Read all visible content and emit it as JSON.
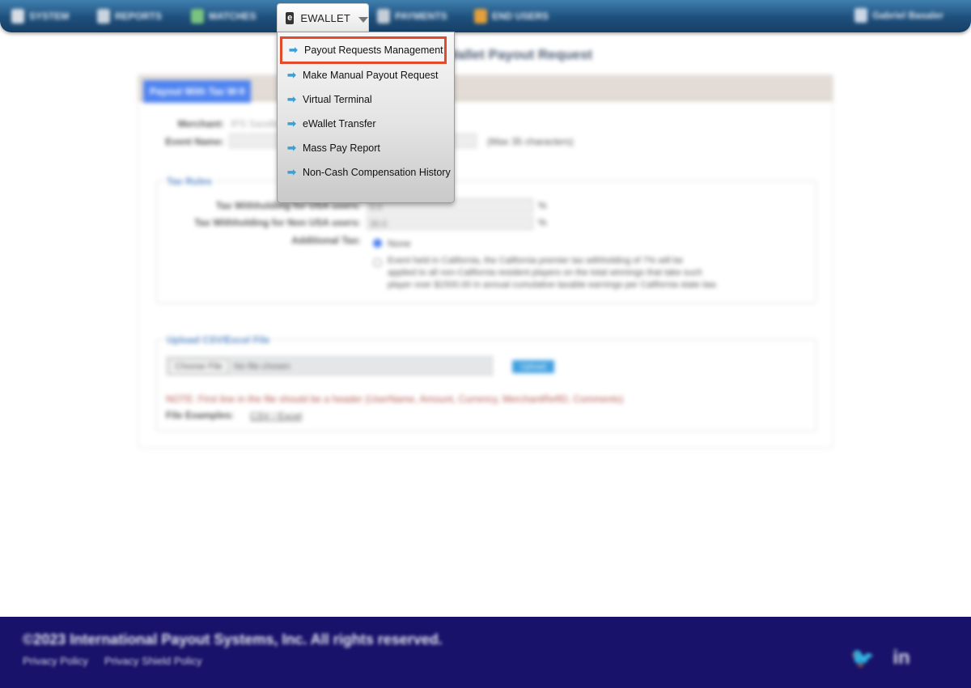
{
  "nav": {
    "items": [
      {
        "label": "SYSTEM",
        "icon": "system-icon",
        "color": "#d7dde5"
      },
      {
        "label": "REPORTS",
        "icon": "reports-icon",
        "color": "#c9d4df"
      },
      {
        "label": "MATCHES",
        "icon": "matches-icon",
        "color": "#7bc47f"
      },
      {
        "label": "PAYMENTS",
        "icon": "payments-icon",
        "color": "#c5ced8"
      },
      {
        "label": "END USERS",
        "icon": "end-users-icon",
        "color": "#e3a03b"
      }
    ],
    "active": {
      "label": "EWALLET",
      "icon_glyph": "e"
    },
    "user_label": "Gabriel Basaler"
  },
  "dropdown": {
    "items": [
      {
        "label": "Payout Requests Management",
        "highlighted": true
      },
      {
        "label": "Make Manual Payout Request",
        "highlighted": false
      },
      {
        "label": "Virtual Terminal",
        "highlighted": false
      },
      {
        "label": "eWallet Transfer",
        "highlighted": false
      },
      {
        "label": "Mass Pay Report",
        "highlighted": false
      },
      {
        "label": "Non-Cash Compensation History",
        "highlighted": false
      }
    ],
    "arrow_glyph": "➡",
    "highlight_color": "#e34a2a"
  },
  "page": {
    "title": "eWallet Payout Request",
    "panel_tab": "Payout With Tax W-9",
    "merchant_label": "Merchant:",
    "merchant_value": "IPS Sandbox",
    "event_label": "Event Name:",
    "event_hint": "(Max 35 characters)",
    "tax": {
      "legend": "Tax Rules",
      "usa_label": "Tax Withholding for USA users:",
      "usa_value": "0.0",
      "non_usa_label": "Tax Withholding for Non USA users:",
      "non_usa_value": "30.0",
      "percent": "%",
      "additional_label": "Additional Tax:",
      "option_none": "None",
      "option_ca_line1": "Event held in California, the California premier tax withholding of 7% will be",
      "option_ca_line2": "applied to all non-California resident players on the total winnings that take such",
      "option_ca_line3": "player over $1500.00 in annual cumulative taxable earnings per California state law."
    },
    "upload": {
      "legend": "Upload CSV/Excel File",
      "choose_label": "Choose File",
      "no_file": "No file chosen",
      "button": "Upload",
      "note": "NOTE: First line in the file should be a header (UserName, Amount, Currency, MerchantRefID, Comments)",
      "examples_label": "File Examples:",
      "example_links": "CSV / Excel"
    }
  },
  "footer": {
    "copyright": "©2023 International Payout Systems, Inc. All rights reserved.",
    "links": [
      "Privacy Policy",
      "Privacy Shield Policy"
    ],
    "social": [
      {
        "name": "twitter-icon",
        "glyph": "🐦"
      },
      {
        "name": "linkedin-icon",
        "glyph": "in"
      }
    ]
  }
}
